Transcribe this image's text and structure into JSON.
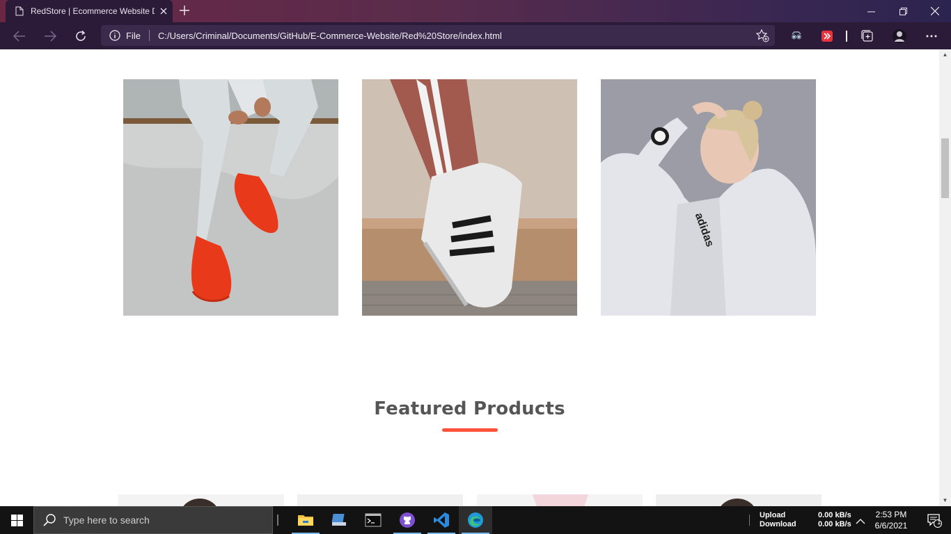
{
  "browser": {
    "tab_title": "RedStore | Ecommerce Website D",
    "address_scheme_label": "File",
    "url": "C:/Users/Criminal/Documents/GitHub/E-Commerce-Website/Red%20Store/index.html"
  },
  "page": {
    "category_images": [
      {
        "alt": "Person in ripped jeans wearing red sneakers"
      },
      {
        "alt": "Striped track pants with white sneaker"
      },
      {
        "alt": "Woman in white hoodie with smartwatch"
      }
    ],
    "featured_title": "Featured Products",
    "accent_color": "#ff523b"
  },
  "taskbar": {
    "search_placeholder": "Type here to search",
    "network_upload_label": "Upload",
    "network_download_label": "Download",
    "network_upload_value": "0.00 kB/s",
    "network_download_value": "0.00 kB/s",
    "time": "2:53 PM",
    "date": "6/6/2021",
    "notification_count": "1"
  },
  "icons": [
    "page-icon",
    "close-icon",
    "plus-icon",
    "minimize-icon",
    "restore-icon",
    "window-close-icon",
    "back-icon",
    "forward-icon",
    "refresh-icon",
    "info-icon",
    "favorite-add-icon",
    "extension-icon",
    "collections-icon",
    "profile-icon",
    "more-icon",
    "windows-icon",
    "search-icon",
    "file-explorer-icon",
    "github-icon",
    "vscode-icon",
    "edge-icon",
    "terminal-icon",
    "notification-icon"
  ]
}
